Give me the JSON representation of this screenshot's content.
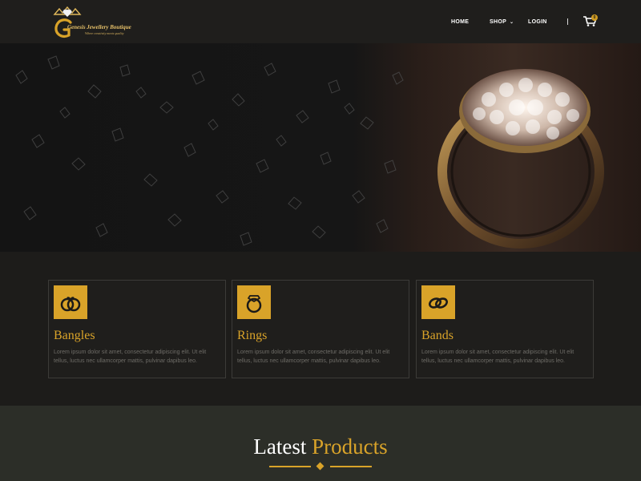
{
  "brand": {
    "name": "Genesis Jewellery Boutique",
    "tagline": "Where creativity meets quality",
    "logo_letter": "G",
    "gold": "#d9a329"
  },
  "nav": {
    "items": [
      {
        "label": "HOME"
      },
      {
        "label": "SHOP",
        "has_dropdown": true
      },
      {
        "label": "LOGIN"
      }
    ],
    "separator": "|",
    "cart_count": "0",
    "cart_icon": "cart-icon"
  },
  "hero": {
    "image": "ring-on-crystals-photo"
  },
  "categories": [
    {
      "title": "Bangles",
      "icon": "bangles-icon",
      "text": "Lorem ipsum dolor sit amet, consectetur adipiscing elit. Ut elit tellus, luctus nec ullamcorper mattis, pulvinar dapibus leo."
    },
    {
      "title": "Rings",
      "icon": "ring-icon",
      "text": "Lorem ipsum dolor sit amet, consectetur adipiscing elit. Ut elit tellus, luctus nec ullamcorper mattis, pulvinar dapibus leo."
    },
    {
      "title": "Bands",
      "icon": "bands-icon",
      "text": "Lorem ipsum dolor sit amet, consectetur adipiscing elit. Ut elit tellus, luctus nec ullamcorper mattis, pulvinar dapibus leo."
    }
  ],
  "latest": {
    "title_plain": "Latest",
    "title_accent": "Products"
  }
}
